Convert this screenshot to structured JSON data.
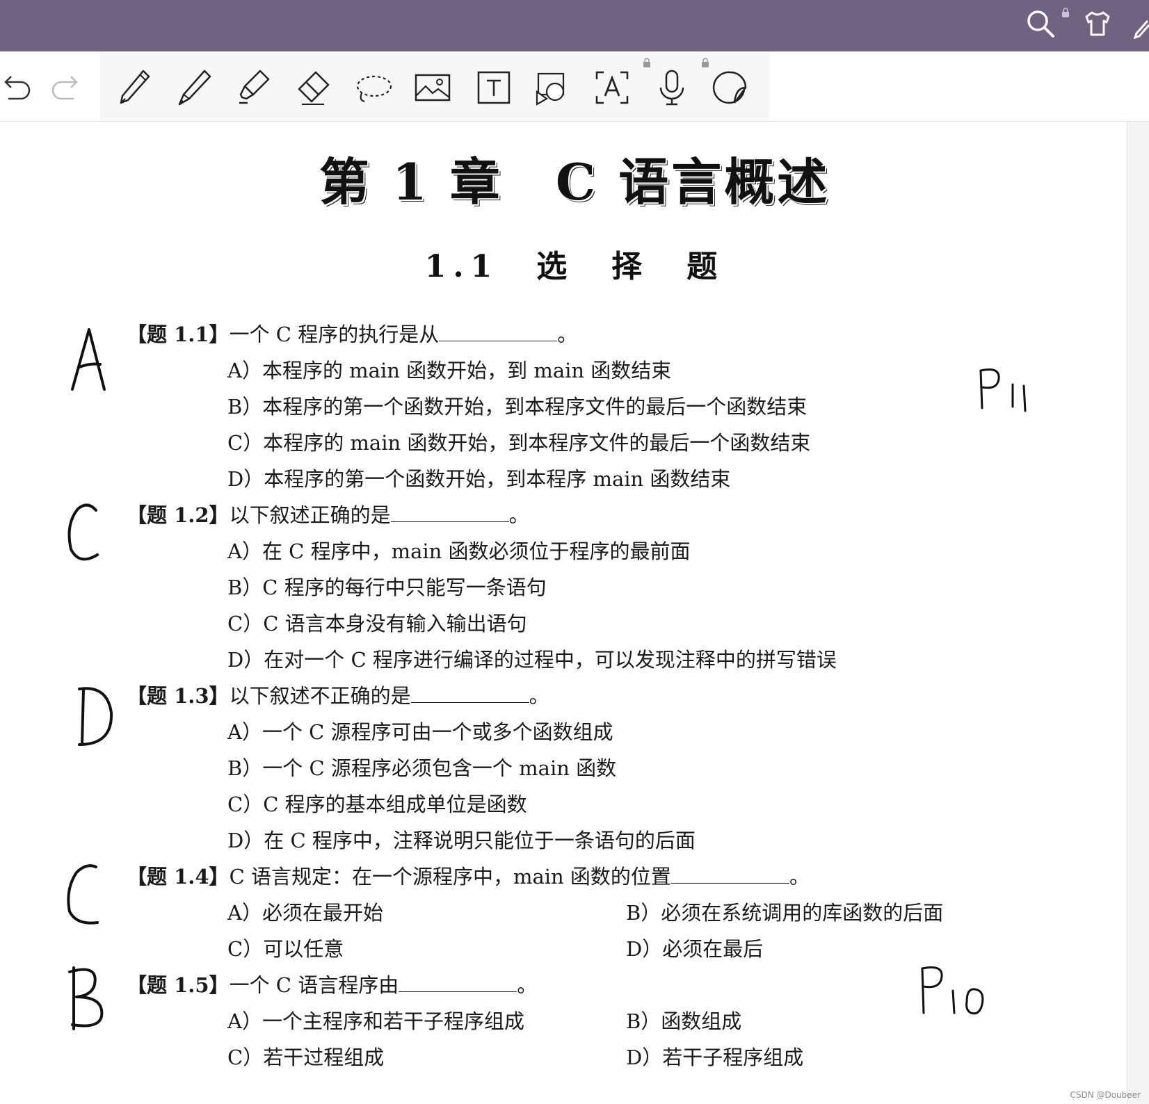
{
  "topbar": {
    "icons": [
      "search-icon",
      "shirt-icon",
      "pen-edge-icon"
    ],
    "color": "#6f6381"
  },
  "toolbar": {
    "tools": [
      "undo-icon",
      "redo-icon",
      "fountain-pen-icon",
      "ballpoint-pen-icon",
      "highlighter-icon",
      "eraser-icon",
      "lasso-icon",
      "image-icon",
      "textbox-icon",
      "shapes-icon",
      "text-recognition-icon",
      "microphone-icon",
      "sticker-icon"
    ]
  },
  "document": {
    "chapter_title": "第 1 章　C 语言概述",
    "section_title": "1.1　选　择　题",
    "questions": [
      {
        "tag": "【题 1.1】",
        "stem": "一个 C 程序的执行是从",
        "end": "。",
        "options": [
          "A）本程序的 main 函数开始，到 main 函数结束",
          "B）本程序的第一个函数开始，到本程序文件的最后一个函数结束",
          "C）本程序的 main 函数开始，到本程序文件的最后一个函数结束",
          "D）本程序的第一个函数开始，到本程序 main 函数结束"
        ]
      },
      {
        "tag": "【题 1.2】",
        "stem": "以下叙述正确的是",
        "end": "。",
        "options": [
          "A）在 C 程序中，main 函数必须位于程序的最前面",
          "B）C 程序的每行中只能写一条语句",
          "C）C 语言本身没有输入输出语句",
          "D）在对一个 C 程序进行编译的过程中，可以发现注释中的拼写错误"
        ]
      },
      {
        "tag": "【题 1.3】",
        "stem": "以下叙述不正确的是",
        "end": "。",
        "options": [
          "A）一个 C 源程序可由一个或多个函数组成",
          "B）一个 C 源程序必须包含一个 main 函数",
          "C）C 程序的基本组成单位是函数",
          "D）在 C 程序中，注释说明只能位于一条语句的后面"
        ]
      },
      {
        "tag": "【题 1.4】",
        "stem": "C 语言规定：在一个源程序中，main 函数的位置",
        "end": "。",
        "options": [
          "A）必须在最开始",
          "B）必须在系统调用的库函数的后面",
          "C）可以任意",
          "D）必须在最后"
        ]
      },
      {
        "tag": "【题 1.5】",
        "stem": "一个 C 语言程序由",
        "end": "。",
        "options": [
          "A）一个主程序和若干子程序组成",
          "B）函数组成",
          "C）若干过程组成",
          "D）若干子程序组成"
        ]
      }
    ],
    "handwritten_answers": [
      "A",
      "C",
      "D",
      "C",
      "B"
    ],
    "handwritten_notes": [
      "P11",
      "P10"
    ]
  },
  "watermark": "CSDN @Doubeer"
}
